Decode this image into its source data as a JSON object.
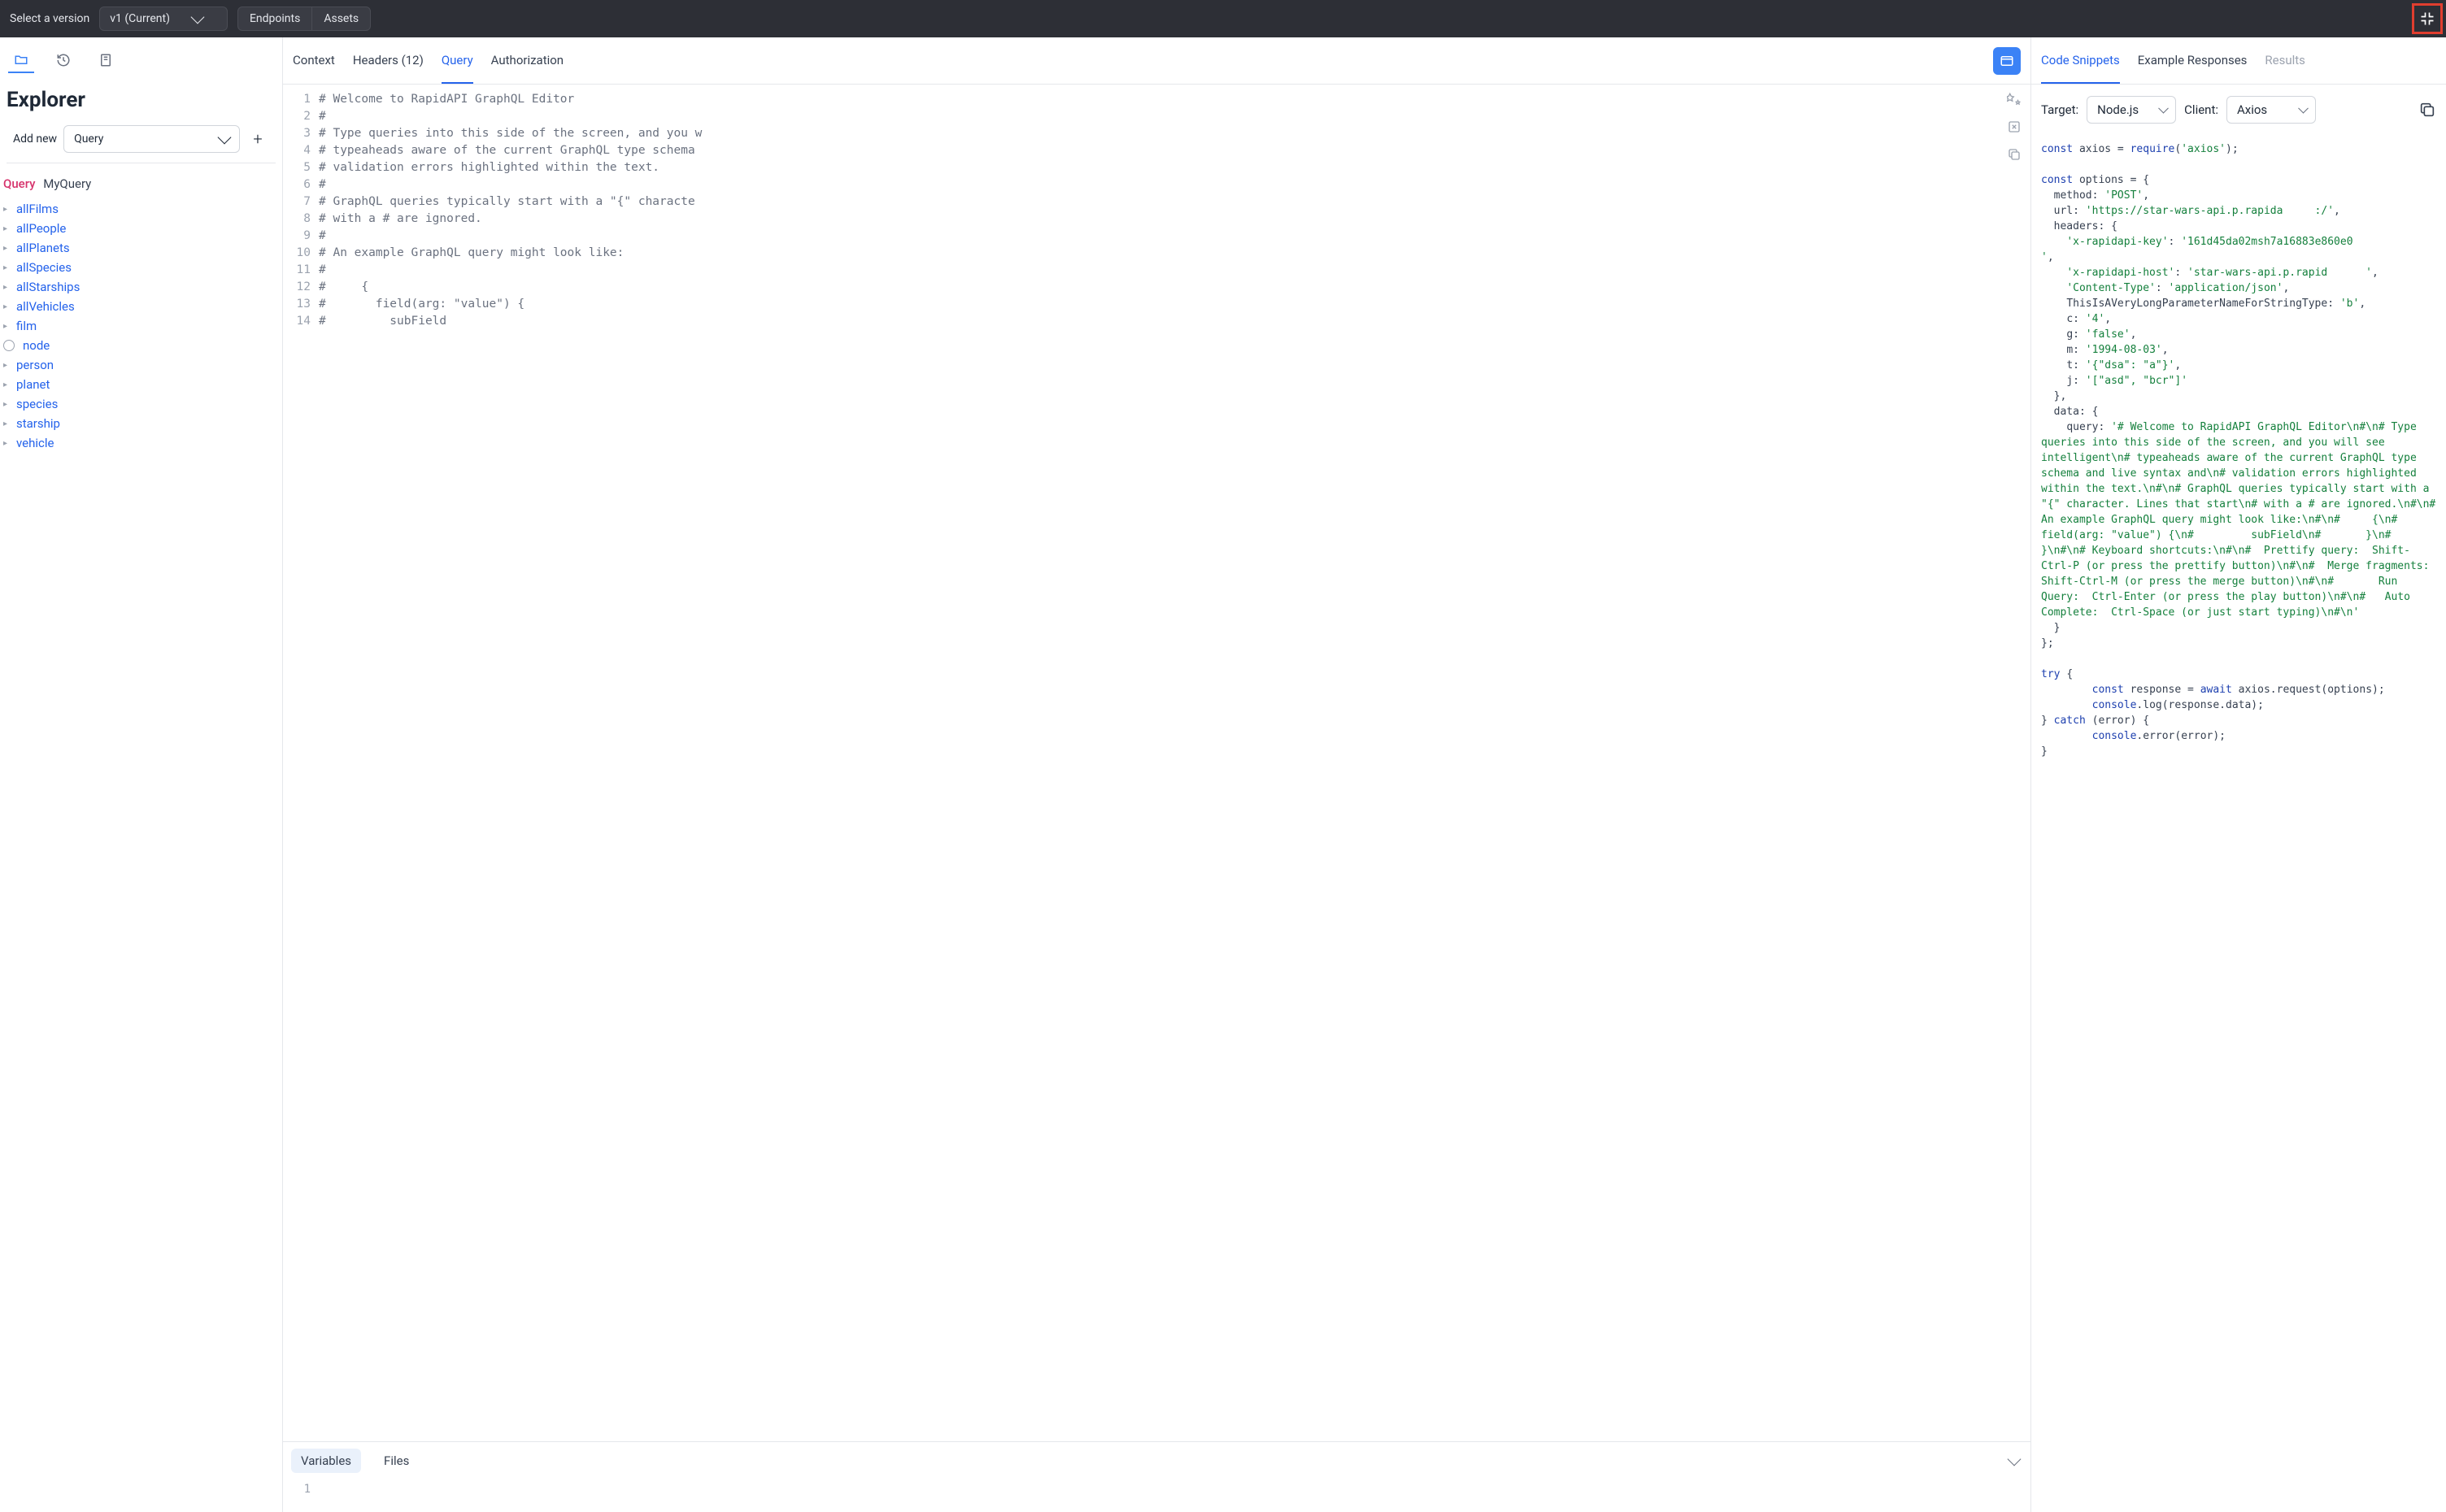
{
  "topbar": {
    "select_label": "Select a version",
    "version": "v1 (Current)",
    "endpoints": "Endpoints",
    "assets": "Assets"
  },
  "sidebar": {
    "title": "Explorer",
    "add_new": "Add new",
    "add_type": "Query",
    "query_kw": "Query",
    "query_name": "MyQuery",
    "items": [
      "allFilms",
      "allPeople",
      "allPlanets",
      "allSpecies",
      "allStarships",
      "allVehicles",
      "film",
      "node",
      "person",
      "planet",
      "species",
      "starship",
      "vehicle"
    ]
  },
  "center": {
    "tabs": {
      "context": "Context",
      "headers": "Headers (12)",
      "query": "Query",
      "authorization": "Authorization"
    },
    "code_lines": [
      "# Welcome to RapidAPI GraphQL Editor",
      "#",
      "# Type queries into this side of the screen, and you w",
      "# typeaheads aware of the current GraphQL type schema",
      "# validation errors highlighted within the text.",
      "#",
      "# GraphQL queries typically start with a \"{\" characte",
      "# with a # are ignored.",
      "#",
      "# An example GraphQL query might look like:",
      "#",
      "#     {",
      "#       field(arg: \"value\") {",
      "#         subField"
    ],
    "bottom": {
      "variables": "Variables",
      "files": "Files",
      "var_line": "1"
    }
  },
  "right": {
    "tabs": {
      "snippets": "Code Snippets",
      "examples": "Example Responses",
      "results": "Results"
    },
    "target_label": "Target:",
    "target_value": "Node.js",
    "client_label": "Client:",
    "client_value": "Axios",
    "snippet_html": "<span class=\"kw\">const</span> <span class=\"plain\">axios = </span><span class=\"kw\">require</span><span class=\"plain\">(</span><span class=\"str\">'axios'</span><span class=\"plain\">);</span>\n\n<span class=\"kw\">const</span> <span class=\"plain\">options = {</span>\n  <span class=\"plain\">method: </span><span class=\"str\">'POST'</span><span class=\"plain\">,</span>\n  <span class=\"plain\">url: </span><span class=\"str\">'https://star-wars-api.p.rapida     :/'</span><span class=\"plain\">,</span>\n  <span class=\"plain\">headers: {</span>\n    <span class=\"str\">'x-rapidapi-key'</span><span class=\"plain\">: </span><span class=\"str\">'161d45da02msh7a16883e860e0                    '</span><span class=\"plain\">,</span>\n    <span class=\"str\">'x-rapidapi-host'</span><span class=\"plain\">: </span><span class=\"str\">'star-wars-api.p.rapid      '</span><span class=\"plain\">,</span>\n    <span class=\"str\">'Content-Type'</span><span class=\"plain\">: </span><span class=\"str\">'application/json'</span><span class=\"plain\">,</span>\n    <span class=\"plain\">ThisIsAVeryLongParameterNameForStringType: </span><span class=\"str\">'b'</span><span class=\"plain\">,</span>\n    <span class=\"plain\">c: </span><span class=\"str\">'4'</span><span class=\"plain\">,</span>\n    <span class=\"plain\">g: </span><span class=\"str\">'false'</span><span class=\"plain\">,</span>\n    <span class=\"plain\">m: </span><span class=\"str\">'1994-08-03'</span><span class=\"plain\">,</span>\n    <span class=\"plain\">t: </span><span class=\"str\">'{\"dsa\": \"a\"}'</span><span class=\"plain\">,</span>\n    <span class=\"plain\">j: </span><span class=\"str\">'[\"asd\", \"bcr\"]'</span>\n  <span class=\"plain\">},</span>\n  <span class=\"plain\">data: {</span>\n    <span class=\"plain\">query: </span><span class=\"str\">'# Welcome to RapidAPI GraphQL Editor\\n#\\n# Type queries into this side of the screen, and you will see intelligent\\n# typeaheads aware of the current GraphQL type schema and live syntax and\\n# validation errors highlighted within the text.\\n#\\n# GraphQL queries typically start with a \"{\" character. Lines that start\\n# with a # are ignored.\\n#\\n# An example GraphQL query might look like:\\n#\\n#     {\\n#       field(arg: \"value\") {\\n#         subField\\n#       }\\n#     }\\n#\\n# Keyboard shortcuts:\\n#\\n#  Prettify query:  Shift-Ctrl-P (or press the prettify button)\\n#\\n#  Merge fragments:  Shift-Ctrl-M (or press the merge button)\\n#\\n#       Run Query:  Ctrl-Enter (or press the play button)\\n#\\n#   Auto Complete:  Ctrl-Space (or just start typing)\\n#\\n'</span>\n  <span class=\"plain\">}</span>\n<span class=\"plain\">};</span>\n\n<span class=\"kw\">try</span> <span class=\"plain\">{</span>\n        <span class=\"kw\">const</span> <span class=\"plain\">response = </span><span class=\"kw\">await</span> <span class=\"plain\">axios.request(options);</span>\n        <span class=\"kw\">console</span><span class=\"plain\">.log(response.data);</span>\n<span class=\"plain\">} </span><span class=\"kw\">catch</span> <span class=\"plain\">(error) {</span>\n        <span class=\"kw\">console</span><span class=\"plain\">.error(error);</span>\n<span class=\"plain\">}</span>"
  }
}
